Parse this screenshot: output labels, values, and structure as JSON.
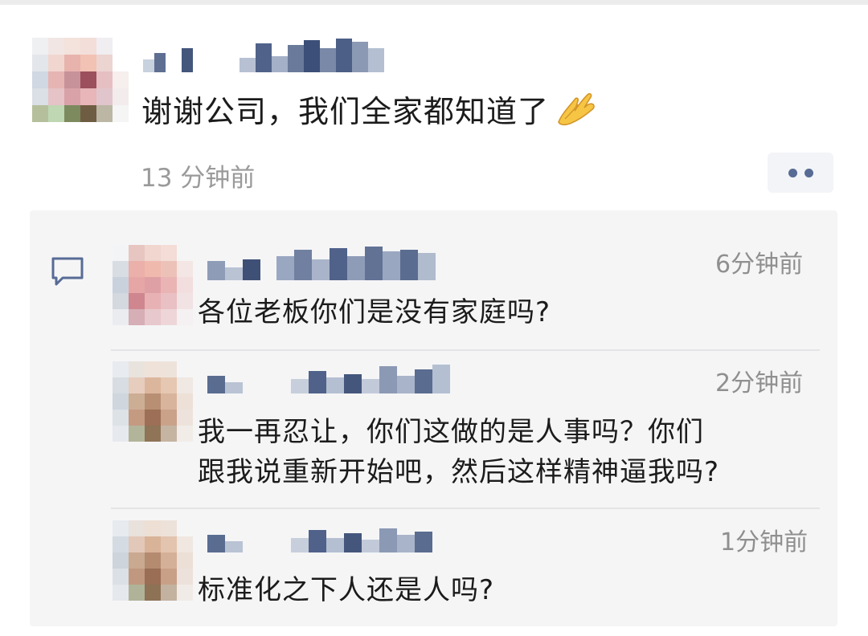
{
  "post": {
    "text": "谢谢公司，我们全家都知道了",
    "emoji": "folded-hands",
    "time": "13 分钟前",
    "more_icon": "more-dots-icon"
  },
  "comments": [
    {
      "time": "6分钟前",
      "text": "各位老板你们是没有家庭吗?"
    },
    {
      "time": "2分钟前",
      "text_line1": "我一再忍让，你们这做的是人事吗？你们",
      "text_line2": "跟我说重新开始吧，然后这样精神逼我吗?"
    },
    {
      "time": "1分钟前",
      "text": "标准化之下人还是人吗?"
    }
  ],
  "colors": {
    "link_blue": "#576b95",
    "time_gray": "#9a9a9a",
    "comment_bg": "#f5f5f6"
  }
}
